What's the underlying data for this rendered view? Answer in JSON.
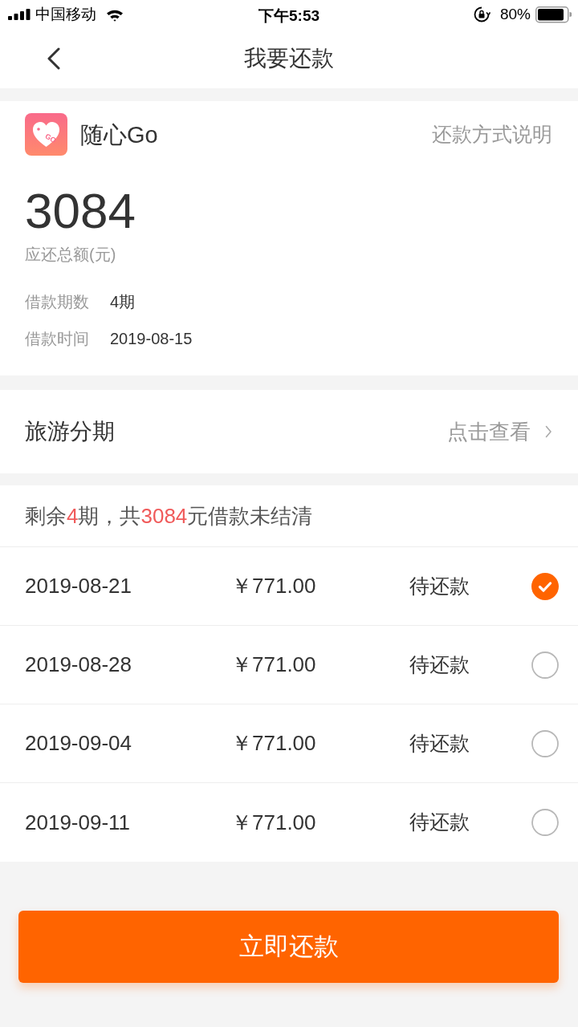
{
  "status_bar": {
    "carrier": "中国移动",
    "time": "下午5:53",
    "battery": "80%"
  },
  "nav": {
    "title": "我要还款"
  },
  "loan": {
    "logo_mark": "GO",
    "product": "随心Go",
    "help_link": "还款方式说明",
    "total": "3084",
    "total_label": "应还总额(元)",
    "details": [
      {
        "label": "借款期数",
        "value": "4期"
      },
      {
        "label": "借款时间",
        "value": "2019-08-15"
      }
    ]
  },
  "plan_row": {
    "label": "旅游分期",
    "action": "点击查看"
  },
  "summary": {
    "parts": [
      {
        "text": "剩余",
        "highlight": false
      },
      {
        "text": "4",
        "highlight": true
      },
      {
        "text": "期，共",
        "highlight": false
      },
      {
        "text": "3084",
        "highlight": true
      },
      {
        "text": "元借款未结清",
        "highlight": false
      }
    ]
  },
  "installments": [
    {
      "date": "2019-08-21",
      "amount": "￥771.00",
      "status": "待还款",
      "selected": true
    },
    {
      "date": "2019-08-28",
      "amount": "￥771.00",
      "status": "待还款",
      "selected": false
    },
    {
      "date": "2019-09-04",
      "amount": "￥771.00",
      "status": "待还款",
      "selected": false
    },
    {
      "date": "2019-09-11",
      "amount": "￥771.00",
      "status": "待还款",
      "selected": false
    }
  ],
  "pay_button": "立即还款"
}
